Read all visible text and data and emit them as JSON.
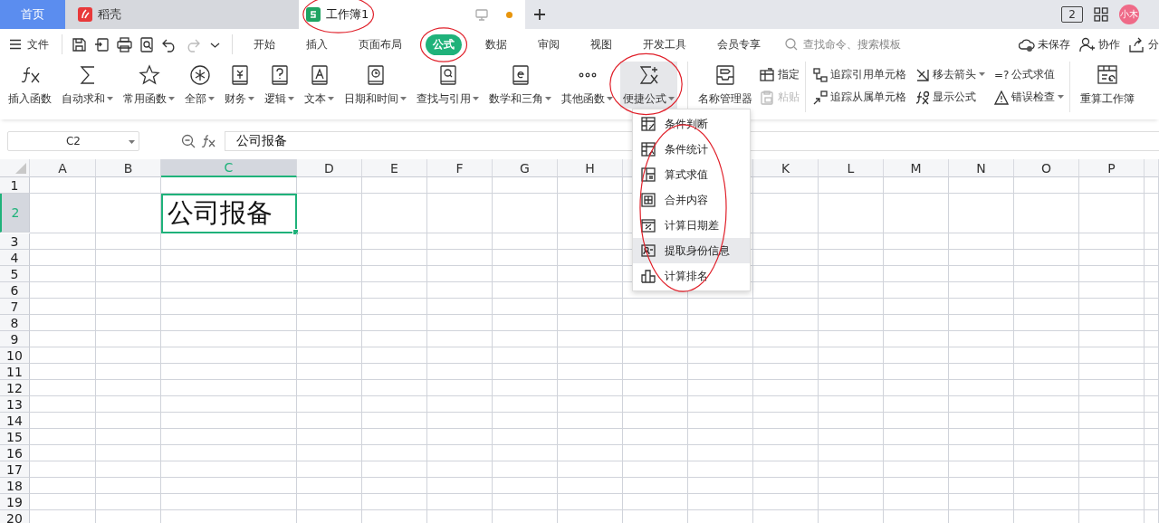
{
  "doc_tabs": [
    {
      "kind": "home",
      "label": "首页",
      "selected": false
    },
    {
      "kind": "shell",
      "label": "稻壳",
      "selected": false
    },
    {
      "kind": "sheet",
      "label": "工作簿1",
      "selected": true,
      "circled": true,
      "unsaved": true
    }
  ],
  "title_bar_right": {
    "badge": "2",
    "avatar": "小木"
  },
  "menu": {
    "file": "文件",
    "tabs": [
      {
        "label": "开始",
        "selected": false
      },
      {
        "label": "插入",
        "selected": false
      },
      {
        "label": "页面布局",
        "selected": false
      },
      {
        "label": "公式",
        "selected": true,
        "circled": true
      },
      {
        "label": "数据",
        "selected": false
      },
      {
        "label": "审阅",
        "selected": false
      },
      {
        "label": "视图",
        "selected": false
      },
      {
        "label": "开发工具",
        "selected": false
      },
      {
        "label": "会员专享",
        "selected": false
      }
    ],
    "search": {
      "placeholder": "查找命令、搜索模板"
    },
    "actions": [
      "未保存",
      "协作",
      "分"
    ]
  },
  "ribbon": {
    "big": [
      {
        "label": "插入函数",
        "caret": false,
        "pressed": false
      },
      {
        "label": "自动求和",
        "caret": true,
        "pressed": false
      },
      {
        "label": "常用函数",
        "caret": true,
        "pressed": false
      },
      {
        "label": "全部",
        "caret": true,
        "pressed": false
      },
      {
        "label": "财务",
        "caret": true,
        "pressed": false
      },
      {
        "label": "逻辑",
        "caret": true,
        "pressed": false
      },
      {
        "label": "文本",
        "caret": true,
        "pressed": false
      },
      {
        "label": "日期和时间",
        "caret": true,
        "pressed": false
      },
      {
        "label": "查找与引用",
        "caret": true,
        "pressed": false
      },
      {
        "label": "数学和三角",
        "caret": true,
        "pressed": false
      },
      {
        "label": "其他函数",
        "caret": true,
        "pressed": false
      },
      {
        "label": "便捷公式",
        "caret": true,
        "pressed": true,
        "circled": true
      }
    ],
    "names": {
      "manager": "名称管理器",
      "small": [
        {
          "label": "指定",
          "disabled": false
        },
        {
          "label": "粘贴",
          "disabled": true
        }
      ]
    },
    "audit": [
      {
        "label": "追踪引用单元格",
        "caret": false
      },
      {
        "label": "追踪从属单元格",
        "caret": false
      },
      {
        "label": "移去箭头",
        "caret": true
      },
      {
        "label": "显示公式",
        "caret": false
      },
      {
        "label": "公式求值",
        "caret": false,
        "prefix": "=?"
      },
      {
        "label": "错误检查",
        "caret": true
      }
    ],
    "recalc": "重算工作簿"
  },
  "formula_bar": {
    "name_box": "C2",
    "value": "公司报备"
  },
  "grid": {
    "columns": [
      {
        "label": "A",
        "selected": false
      },
      {
        "label": "B",
        "selected": false
      },
      {
        "label": "C",
        "selected": true
      },
      {
        "label": "D",
        "selected": false
      },
      {
        "label": "E",
        "selected": false
      },
      {
        "label": "F",
        "selected": false
      },
      {
        "label": "G",
        "selected": false
      },
      {
        "label": "H",
        "selected": false
      },
      {
        "selected": false
      },
      {
        "selected": false
      },
      {
        "label": "K",
        "selected": false
      },
      {
        "label": "L",
        "selected": false
      },
      {
        "label": "M",
        "selected": false
      },
      {
        "label": "N",
        "selected": false
      },
      {
        "label": "O",
        "selected": false
      },
      {
        "label": "P",
        "selected": false
      }
    ],
    "rows": [
      {
        "label": "1",
        "selected": false
      },
      {
        "label": "2",
        "selected": true,
        "cells": [
          null,
          null,
          {
            "text": "公司报备",
            "selected": true
          }
        ]
      },
      {
        "label": "3",
        "selected": false
      },
      {
        "label": "4",
        "selected": false
      },
      {
        "label": "5",
        "selected": false
      },
      {
        "label": "6",
        "selected": false
      },
      {
        "label": "7",
        "selected": false
      },
      {
        "label": "8",
        "selected": false
      },
      {
        "label": "9",
        "selected": false
      },
      {
        "label": "10",
        "selected": false
      },
      {
        "label": "11",
        "selected": false
      },
      {
        "label": "12",
        "selected": false
      },
      {
        "label": "13",
        "selected": false
      },
      {
        "label": "14",
        "selected": false
      },
      {
        "label": "15",
        "selected": false
      },
      {
        "label": "16",
        "selected": false
      },
      {
        "label": "17",
        "selected": false
      },
      {
        "label": "18",
        "selected": false
      },
      {
        "label": "19",
        "selected": false
      },
      {
        "label": "20",
        "selected": false
      }
    ]
  },
  "dropdown": {
    "circled": true,
    "items": [
      {
        "label": "条件判断",
        "selected": false
      },
      {
        "label": "条件统计",
        "selected": false
      },
      {
        "label": "算式求值",
        "selected": false
      },
      {
        "label": "合并内容",
        "selected": false
      },
      {
        "label": "计算日期差",
        "selected": false
      },
      {
        "label": "提取身份信息",
        "selected": true
      },
      {
        "label": "计算排名",
        "selected": false
      }
    ]
  }
}
